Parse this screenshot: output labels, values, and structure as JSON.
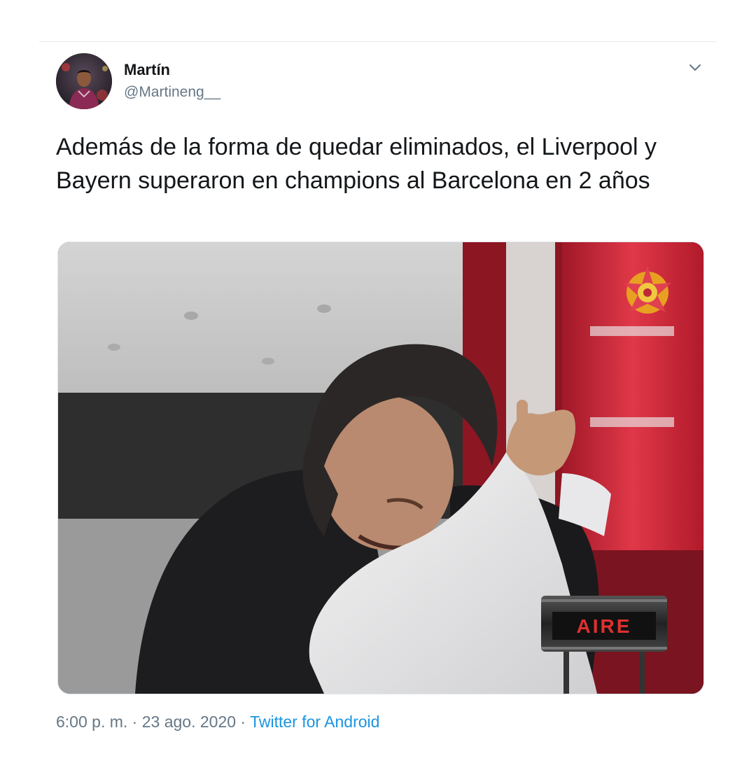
{
  "tweet": {
    "author": {
      "display_name": "Martín",
      "handle": "@Martineng__"
    },
    "text": "Además de la forma de quedar eliminados, el Liverpool y Bayern superaron en champions al Barcelona en 2 años",
    "media": {
      "overlay_text": "AIRE"
    },
    "meta": {
      "time": "6:00 p. m.",
      "separator": "·",
      "date": "23 ago. 2020",
      "source": "Twitter for Android"
    }
  },
  "icons": {
    "menu": "chevron-down-icon"
  },
  "colors": {
    "text_primary": "#14171a",
    "text_secondary": "#657786",
    "link": "#1b95e0",
    "divider": "#e6ecf0"
  }
}
